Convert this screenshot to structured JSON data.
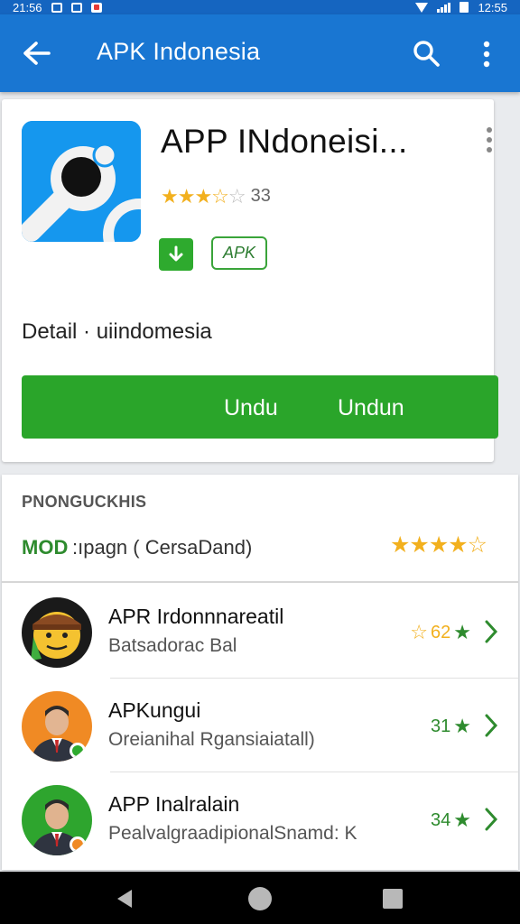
{
  "status_bar": {
    "time": "12:55",
    "left_text": "21:56"
  },
  "app_bar": {
    "title": "APK Indonesia",
    "back_icon": "arrow-back-icon",
    "search_icon": "search-icon",
    "more_icon": "more-vert-icon"
  },
  "app": {
    "name": "APP INdoneisi...",
    "rating_stars": 3.5,
    "rating_count": "33",
    "badge_icon": "download-icon",
    "badge_label": "APK",
    "detail": "Detail · uiindomesia",
    "button_labels": [
      "Undu",
      "Undun"
    ],
    "accent_color": "#2aa52a"
  },
  "section": {
    "title": "PNONGUCKHIS",
    "mod": {
      "tag": "MOD",
      "text": ":ıpagn ( CersaDand)",
      "stars": 4.5
    },
    "rows": [
      {
        "title": "APR Irdonnnareatil",
        "subtitle": "Batsadorac Bal",
        "rating": "62",
        "avatar": "emoji-avatar"
      },
      {
        "title": "APKungui",
        "subtitle": "Oreianihal Rgansiaiatall)",
        "rating": "31",
        "avatar": "man-avatar-orange"
      },
      {
        "title": "APP Inalralain",
        "subtitle": "PealvalgraadipionalSnamd: K",
        "rating": "34",
        "avatar": "man-avatar-green"
      }
    ]
  },
  "nav_bar": {
    "back": "nav-back-icon",
    "home": "nav-home-icon",
    "recent": "nav-recent-icon"
  }
}
